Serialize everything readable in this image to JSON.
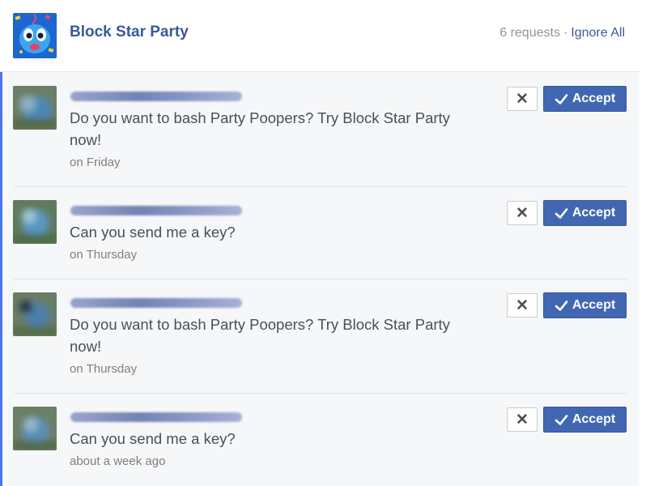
{
  "header": {
    "app_title": "Block Star Party",
    "requests_label": "6 requests",
    "separator": "·",
    "ignore_all_label": "Ignore All"
  },
  "colors": {
    "brand_blue": "#3b5998",
    "accent_button": "#4267b2",
    "list_left_accent": "#4a76e8",
    "list_bg": "#f6f7f9"
  },
  "requests": [
    {
      "message_line1": "Do you want to bash Party Poopers? Try Block Star Party",
      "message_line2": "now!",
      "time": "on Friday",
      "dismiss_icon": "close-icon",
      "accept_label": "Accept"
    },
    {
      "message_line1": "Can you send me a key?",
      "message_line2": "",
      "time": "on Thursday",
      "dismiss_icon": "close-icon",
      "accept_label": "Accept"
    },
    {
      "message_line1": "Do you want to bash Party Poopers? Try Block Star Party",
      "message_line2": "now!",
      "time": "on Thursday",
      "dismiss_icon": "close-icon",
      "accept_label": "Accept"
    },
    {
      "message_line1": "Can you send me a key?",
      "message_line2": "",
      "time": "about a week ago",
      "dismiss_icon": "close-icon",
      "accept_label": "Accept"
    }
  ]
}
